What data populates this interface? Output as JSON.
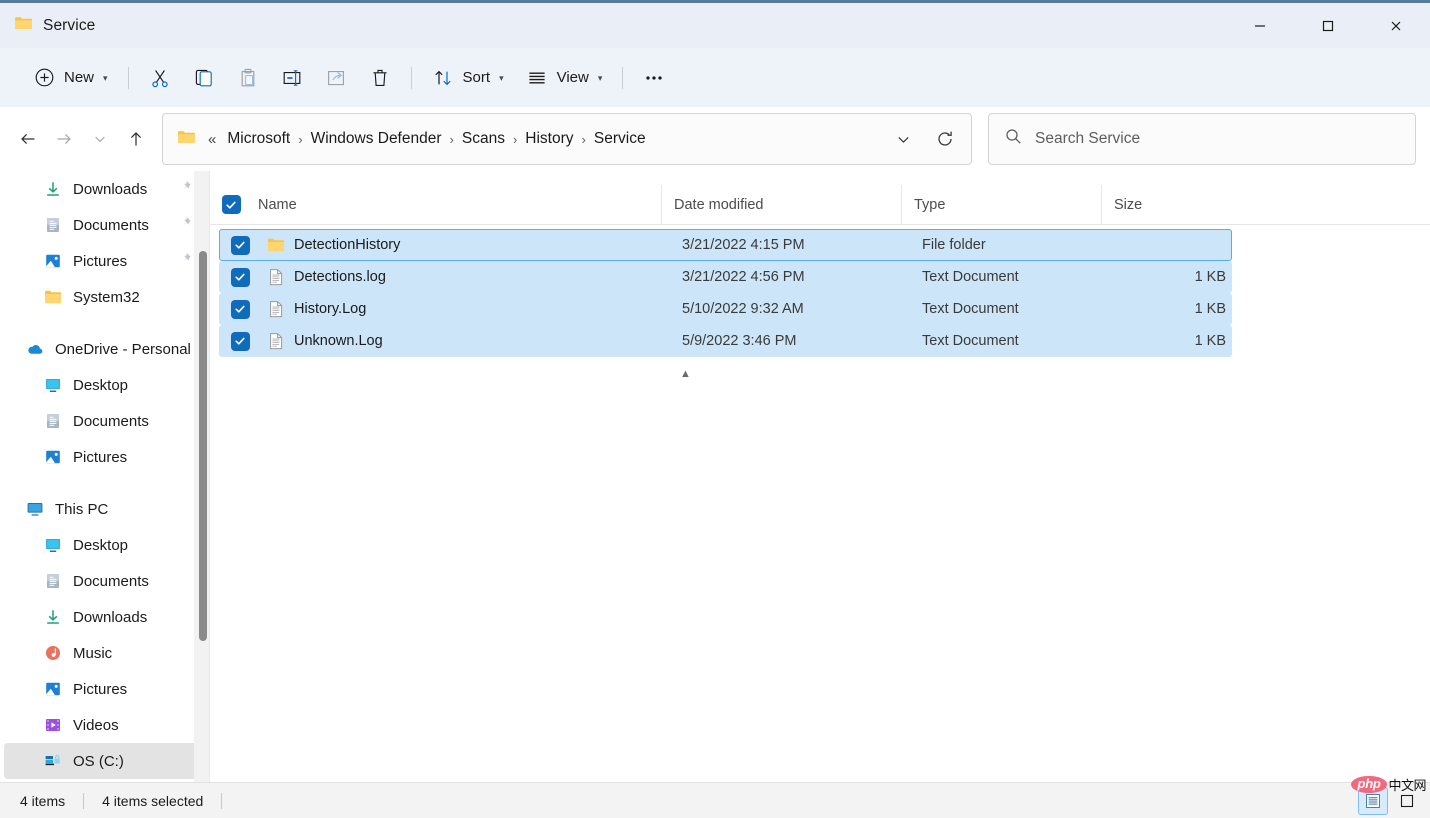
{
  "window": {
    "title": "Service",
    "controls": {
      "minimize": "—",
      "maximize": "□",
      "close": "✕"
    }
  },
  "toolbar": {
    "new_label": "New",
    "cut_label": "Cut",
    "copy_label": "Copy",
    "paste_label": "Paste",
    "rename_label": "Rename",
    "share_label": "Share",
    "delete_label": "Delete",
    "sort_label": "Sort",
    "view_label": "View",
    "more_label": "•••"
  },
  "address": {
    "ellipsis": "«",
    "crumbs": [
      "Microsoft",
      "Windows Defender",
      "Scans",
      "History",
      "Service"
    ],
    "separator": "›"
  },
  "search": {
    "placeholder": "Search Service",
    "value": ""
  },
  "sidebar": {
    "groups": [
      {
        "items": [
          {
            "label": "Downloads",
            "icon": "download-icon",
            "pinned": true,
            "indent": true
          },
          {
            "label": "Documents",
            "icon": "documents-icon",
            "pinned": true,
            "indent": true
          },
          {
            "label": "Pictures",
            "icon": "pictures-icon",
            "pinned": true,
            "indent": true
          },
          {
            "label": "System32",
            "icon": "folder-icon",
            "pinned": false,
            "indent": true
          }
        ]
      },
      {
        "items": [
          {
            "label": "OneDrive - Personal",
            "icon": "onedrive-icon",
            "pinned": false,
            "indent": false
          },
          {
            "label": "Desktop",
            "icon": "desktop-icon",
            "pinned": false,
            "indent": true
          },
          {
            "label": "Documents",
            "icon": "documents-icon",
            "pinned": false,
            "indent": true
          },
          {
            "label": "Pictures",
            "icon": "pictures-icon",
            "pinned": false,
            "indent": true
          }
        ]
      },
      {
        "items": [
          {
            "label": "This PC",
            "icon": "thispc-icon",
            "pinned": false,
            "indent": false
          },
          {
            "label": "Desktop",
            "icon": "desktop-icon",
            "pinned": false,
            "indent": true
          },
          {
            "label": "Documents",
            "icon": "documents-icon",
            "pinned": false,
            "indent": true
          },
          {
            "label": "Downloads",
            "icon": "download-icon",
            "pinned": false,
            "indent": true
          },
          {
            "label": "Music",
            "icon": "music-icon",
            "pinned": false,
            "indent": true
          },
          {
            "label": "Pictures",
            "icon": "pictures-icon",
            "pinned": false,
            "indent": true
          },
          {
            "label": "Videos",
            "icon": "videos-icon",
            "pinned": false,
            "indent": true
          },
          {
            "label": "OS (C:)",
            "icon": "drive-icon",
            "pinned": false,
            "indent": true,
            "hovered": true
          }
        ]
      }
    ]
  },
  "filelist": {
    "sort_column": "Name",
    "sort_direction": "ascending",
    "select_all_checked": true,
    "columns": [
      "Name",
      "Date modified",
      "Type",
      "Size"
    ],
    "rows": [
      {
        "checked": true,
        "icon": "folder-icon",
        "name": "DetectionHistory",
        "date": "3/21/2022 4:15 PM",
        "type": "File folder",
        "size": "",
        "focused": true
      },
      {
        "checked": true,
        "icon": "document-icon",
        "name": "Detections.log",
        "date": "3/21/2022 4:56 PM",
        "type": "Text Document",
        "size": "1 KB",
        "focused": false
      },
      {
        "checked": true,
        "icon": "document-icon",
        "name": "History.Log",
        "date": "5/10/2022 9:32 AM",
        "type": "Text Document",
        "size": "1 KB",
        "focused": false
      },
      {
        "checked": true,
        "icon": "document-icon",
        "name": "Unknown.Log",
        "date": "5/9/2022 3:46 PM",
        "type": "Text Document",
        "size": "1 KB",
        "focused": false
      }
    ]
  },
  "statusbar": {
    "item_count": "4 items",
    "selection": "4 items selected",
    "details_view_label": "Details view",
    "large_icons_view_label": "Large icons view"
  },
  "watermark": {
    "php": "php",
    "cn": "中文网"
  },
  "colors": {
    "accent": "#0f6cbd",
    "selection": "#cde5f8",
    "focus_outline": "#5aaeee",
    "titlebar": "#eaeff7",
    "commandbar": "#eef3fa",
    "folder_yellow": "#ffca42"
  }
}
